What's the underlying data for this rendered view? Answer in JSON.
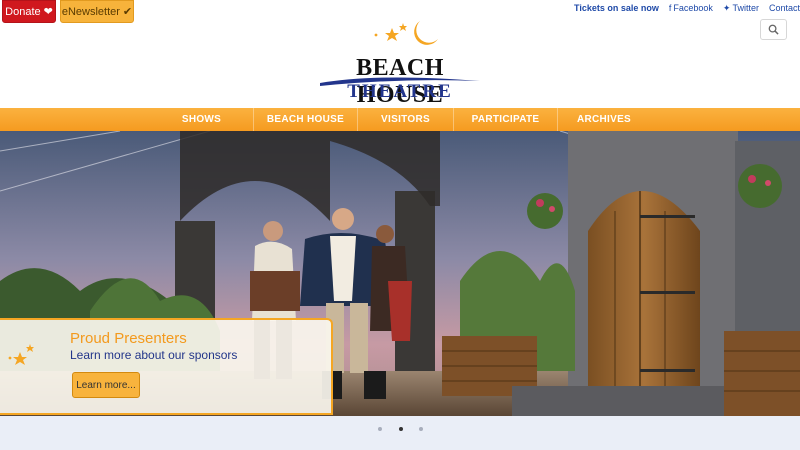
{
  "top": {
    "donate_label": "Donate",
    "newsletter_label": "eNewsletter",
    "tickets_text": "Tickets on sale now",
    "facebook_label": "Facebook",
    "twitter_label": "Twitter",
    "contact_label": "Contact"
  },
  "logo": {
    "line1": "BEACH HOUSE",
    "line2": "THEATRE"
  },
  "nav": {
    "items": [
      "SHOWS",
      "BEACH HOUSE",
      "VISITORS",
      "PARTICIPATE",
      "ARCHIVES"
    ]
  },
  "promo": {
    "title": "Proud Presenters",
    "subtitle": "Learn more about our sponsors",
    "button_label": "Learn more..."
  },
  "carousel": {
    "slide_count": 3,
    "active_index": 1
  },
  "colors": {
    "accent": "#f5a623",
    "donate": "#d0181e",
    "brand_blue": "#23368a"
  },
  "icons": [
    "heart-icon",
    "check-icon",
    "facebook-icon",
    "twitter-icon",
    "search-icon",
    "moon-stars-icon"
  ]
}
